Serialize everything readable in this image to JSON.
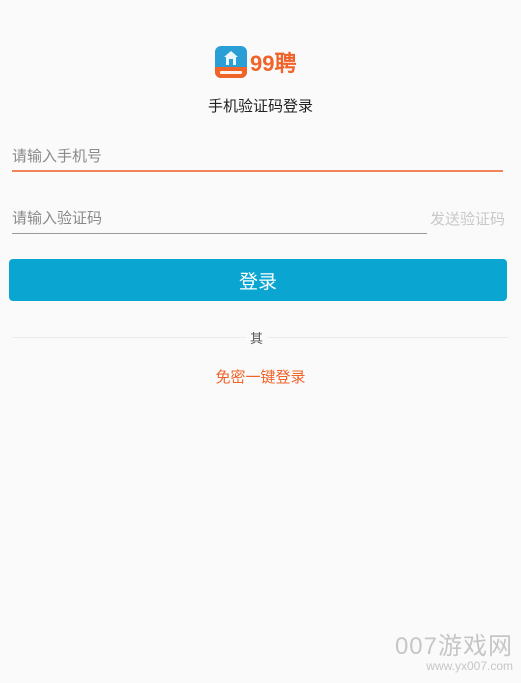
{
  "logo": {
    "text": "99聘"
  },
  "title": "手机验证码登录",
  "phone_field": {
    "placeholder": "请输入手机号",
    "value": ""
  },
  "code_field": {
    "placeholder": "请输入验证码",
    "value": ""
  },
  "send_code_label": "发送验证码",
  "login_label": "登录",
  "other_label": "其",
  "one_click_label": "免密一键登录",
  "watermark": {
    "main": "007游戏网",
    "url": "www.yx007.com"
  },
  "colors": {
    "accent_blue": "#0aa6d1",
    "accent_orange": "#f0642a",
    "phone_underline": "#f0855a"
  },
  "icons": {
    "logo": "house-badge-icon"
  }
}
